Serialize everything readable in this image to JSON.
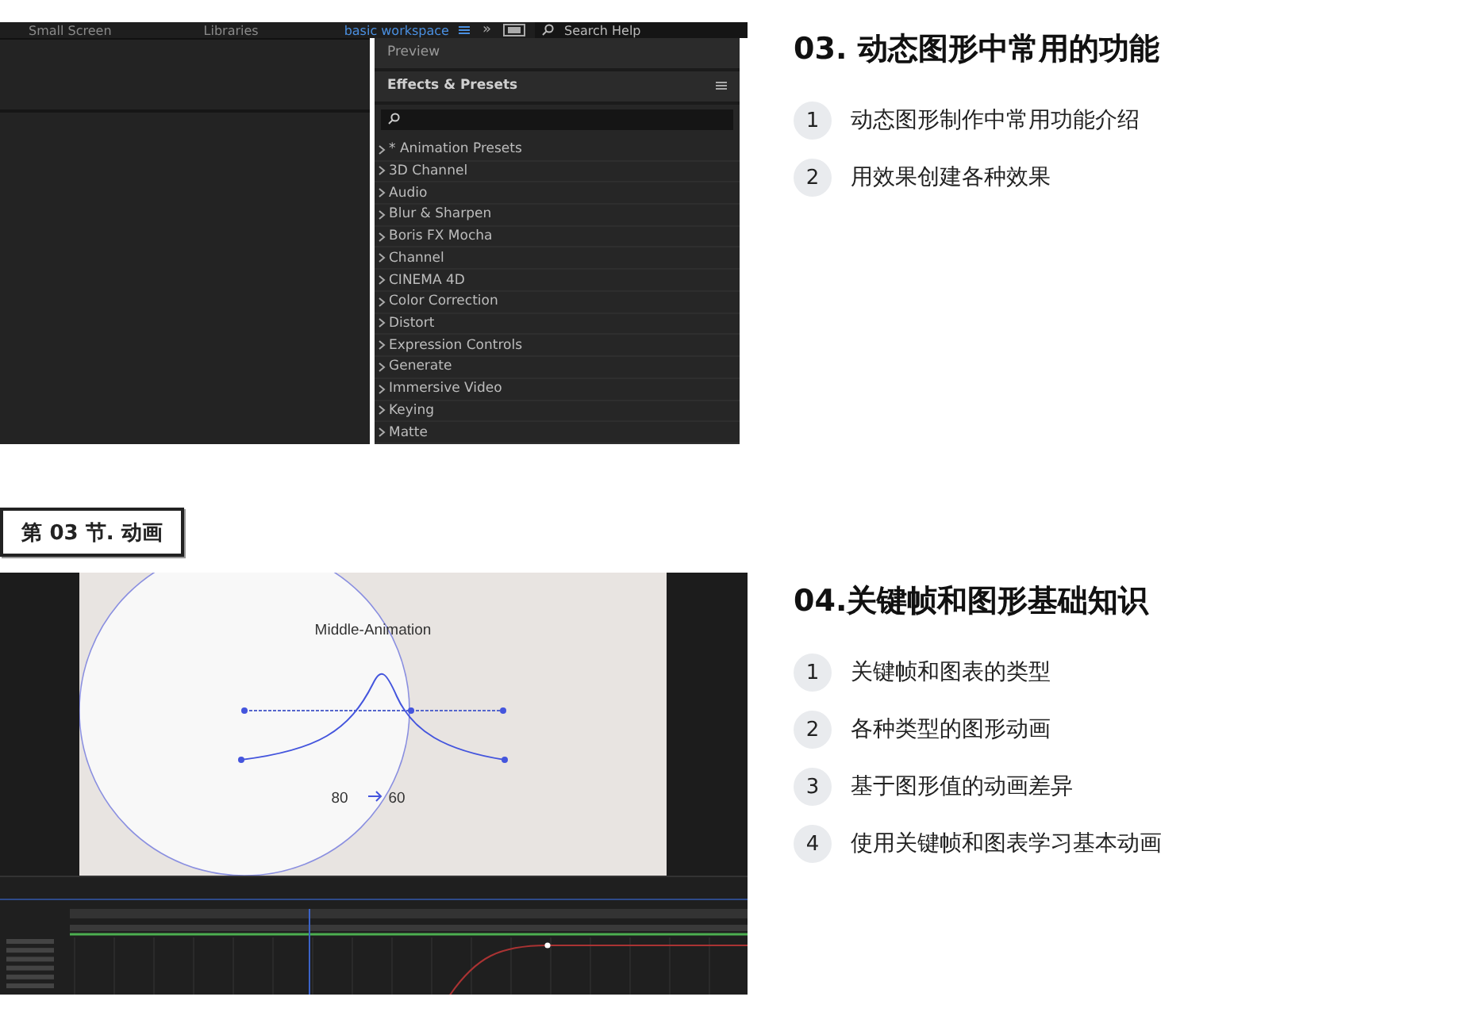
{
  "section_1": {
    "screenshot": {
      "top_bar": {
        "tabs": [
          {
            "label": "Small Screen",
            "selected": false
          },
          {
            "label": "Libraries",
            "selected": false
          },
          {
            "label": "basic workspace",
            "selected": true
          }
        ],
        "overflow": "»",
        "search": {
          "placeholder": "Search Help"
        }
      },
      "preview_title": "Preview",
      "effects": {
        "title": "Effects & Presets",
        "items": [
          "* Animation Presets",
          "3D Channel",
          "Audio",
          "Blur & Sharpen",
          "Boris FX Mocha",
          "Channel",
          "CINEMA 4D",
          "Color Correction",
          "Distort",
          "Expression Controls",
          "Generate",
          "Immersive Video",
          "Keying",
          "Matte"
        ]
      }
    },
    "title": "03. 动态图形中常用的功能",
    "items": [
      {
        "number": "1",
        "text": "动态图形制作中常用功能介绍"
      },
      {
        "number": "2",
        "text": "用效果创建各种效果"
      }
    ]
  },
  "section_label": "第 03 节. 动画",
  "section_2": {
    "screenshot": {
      "canvas_title": "Middle-Animation",
      "value_from": "80",
      "value_to": "60"
    },
    "title": "04.关键帧和图形基础知识",
    "items": [
      {
        "number": "1",
        "text": "关键帧和图表的类型"
      },
      {
        "number": "2",
        "text": "各种类型的图形动画"
      },
      {
        "number": "3",
        "text": "基于图形值的动画差异"
      },
      {
        "number": "4",
        "text": "使用关键帧和图表学习基本动画"
      }
    ]
  }
}
